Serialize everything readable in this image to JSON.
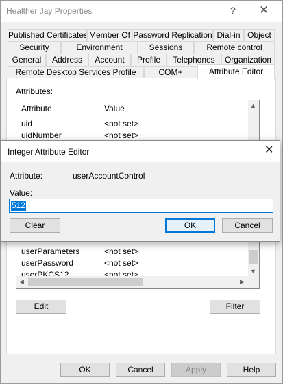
{
  "window": {
    "title": "Healther Jay Properties",
    "help_glyph": "?",
    "close_glyph": "✕"
  },
  "tabs": {
    "row1": [
      "Published Certificates",
      "Member Of",
      "Password Replication",
      "Dial-in",
      "Object"
    ],
    "row2": [
      "Security",
      "Environment",
      "Sessions",
      "Remote control"
    ],
    "row3": [
      "General",
      "Address",
      "Account",
      "Profile",
      "Telephones",
      "Organization"
    ],
    "row4": [
      "Remote Desktop Services Profile",
      "COM+",
      "Attribute Editor"
    ],
    "active": "Attribute Editor"
  },
  "attribute_editor": {
    "attributes_label": "Attributes:",
    "columns": [
      "Attribute",
      "Value"
    ],
    "rows_top": [
      {
        "name": "uid",
        "value": "<not set>"
      },
      {
        "name": "uidNumber",
        "value": "<not set>"
      }
    ],
    "rows_bottom": [
      {
        "name": "userParameters",
        "value": "<not set>"
      },
      {
        "name": "userPassword",
        "value": "<not set>"
      },
      {
        "name": "userPKCS12",
        "value": "<not set>"
      }
    ],
    "edit_label": "Edit",
    "filter_label": "Filter"
  },
  "footer": {
    "ok": "OK",
    "cancel": "Cancel",
    "apply": "Apply",
    "help": "Help"
  },
  "dialog": {
    "title": "Integer Attribute Editor",
    "close_glyph": "✕",
    "attribute_label": "Attribute:",
    "attribute_value": "userAccountControl",
    "value_label": "Value:",
    "value": "512",
    "clear": "Clear",
    "ok": "OK",
    "cancel": "Cancel"
  },
  "colors": {
    "accent": "#0078d7",
    "window_bg": "#f0f0f0"
  }
}
